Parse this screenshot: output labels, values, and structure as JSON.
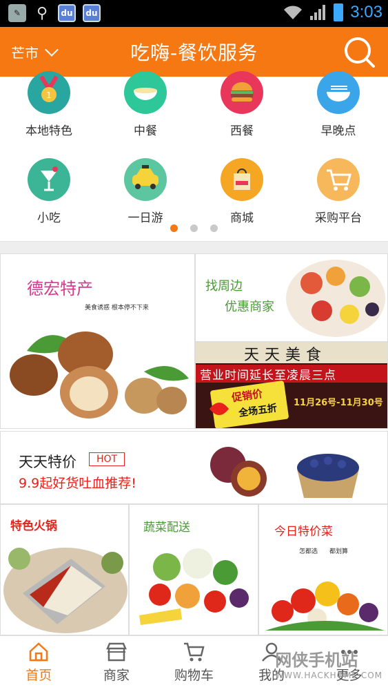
{
  "status_bar": {
    "time": "3:03",
    "app_badge": "du"
  },
  "header": {
    "city": "芒市",
    "title": "吃嗨-餐饮服务"
  },
  "categories": [
    {
      "label": "本地特色",
      "icon": "medal-icon",
      "color": "#2aa6a0"
    },
    {
      "label": "中餐",
      "icon": "soup-bowl-icon",
      "color": "#2dc79a"
    },
    {
      "label": "西餐",
      "icon": "burger-icon",
      "color": "#e8375a"
    },
    {
      "label": "早晚点",
      "icon": "noodle-bowl-icon",
      "color": "#3aa5e8"
    },
    {
      "label": "小吃",
      "icon": "cocktail-icon",
      "color": "#3bb596"
    },
    {
      "label": "一日游",
      "icon": "taxi-icon",
      "color": "#5bc6a0"
    },
    {
      "label": "商城",
      "icon": "shopping-bag-icon",
      "color": "#f5a623"
    },
    {
      "label": "采购平台",
      "icon": "cart-icon",
      "color": "#f6b85a"
    }
  ],
  "carousel": {
    "pages": 3,
    "active": 0
  },
  "promos": {
    "dehong": {
      "title": "德宏特产",
      "subtitle": "美食诱惑 根本停不下来"
    },
    "nearby": {
      "line1": "找周边",
      "line2": "优惠商家"
    },
    "tiantian_shop": {
      "sign": "天天美食",
      "banner": "营业时间延长至凌晨三点",
      "promo_tag": "促销价",
      "promo_text": "全场五折",
      "dates": "11月26号-11月30号"
    },
    "daily_deal": {
      "title": "天天特价",
      "badge": "HOT",
      "subtitle": "9.9起好货吐血推荐!"
    },
    "hotpot": {
      "title": "特色火锅"
    },
    "veg_delivery": {
      "title": "蔬菜配送"
    },
    "today_veg": {
      "title": "今日特价菜",
      "sub1": "怎都选",
      "sub2": "都划算"
    }
  },
  "bottom_nav": [
    {
      "label": "首页",
      "icon": "home-icon",
      "active": true
    },
    {
      "label": "商家",
      "icon": "store-icon",
      "active": false
    },
    {
      "label": "购物车",
      "icon": "shopping-cart-icon",
      "active": false
    },
    {
      "label": "我的",
      "icon": "user-icon",
      "active": false
    },
    {
      "label": "更多",
      "icon": "more-icon",
      "active": false
    }
  ],
  "watermark": {
    "text": "网侠手机站",
    "url": "WWW.HACKHOME.COM"
  },
  "colors": {
    "accent": "#f67813",
    "hot_red": "#e8375a"
  }
}
